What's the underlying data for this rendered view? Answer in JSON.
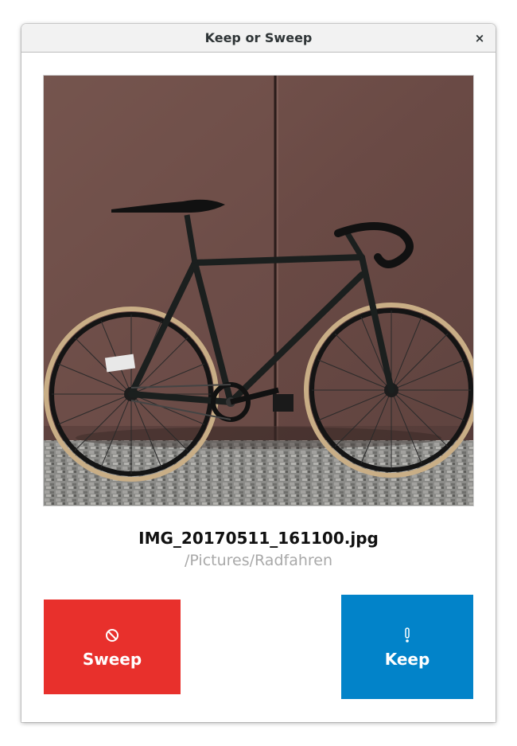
{
  "window": {
    "title": "Keep or Sweep",
    "close_glyph": "×"
  },
  "file": {
    "name": "IMG_20170511_161100.jpg",
    "path": "/Pictures/Radfahren"
  },
  "buttons": {
    "sweep": {
      "label": "Sweep",
      "icon": "no-entry-icon",
      "color": "#e8302c"
    },
    "keep": {
      "label": "Keep",
      "icon": "exclamation-icon",
      "color": "#0283c9"
    }
  },
  "photo": {
    "description_icon": "bicycle-photo"
  },
  "colors": {
    "title_text": "#2e3436",
    "path_text": "#a9a9a9",
    "wall": "#6b4c48",
    "cobblestone": "#8a8a88"
  }
}
